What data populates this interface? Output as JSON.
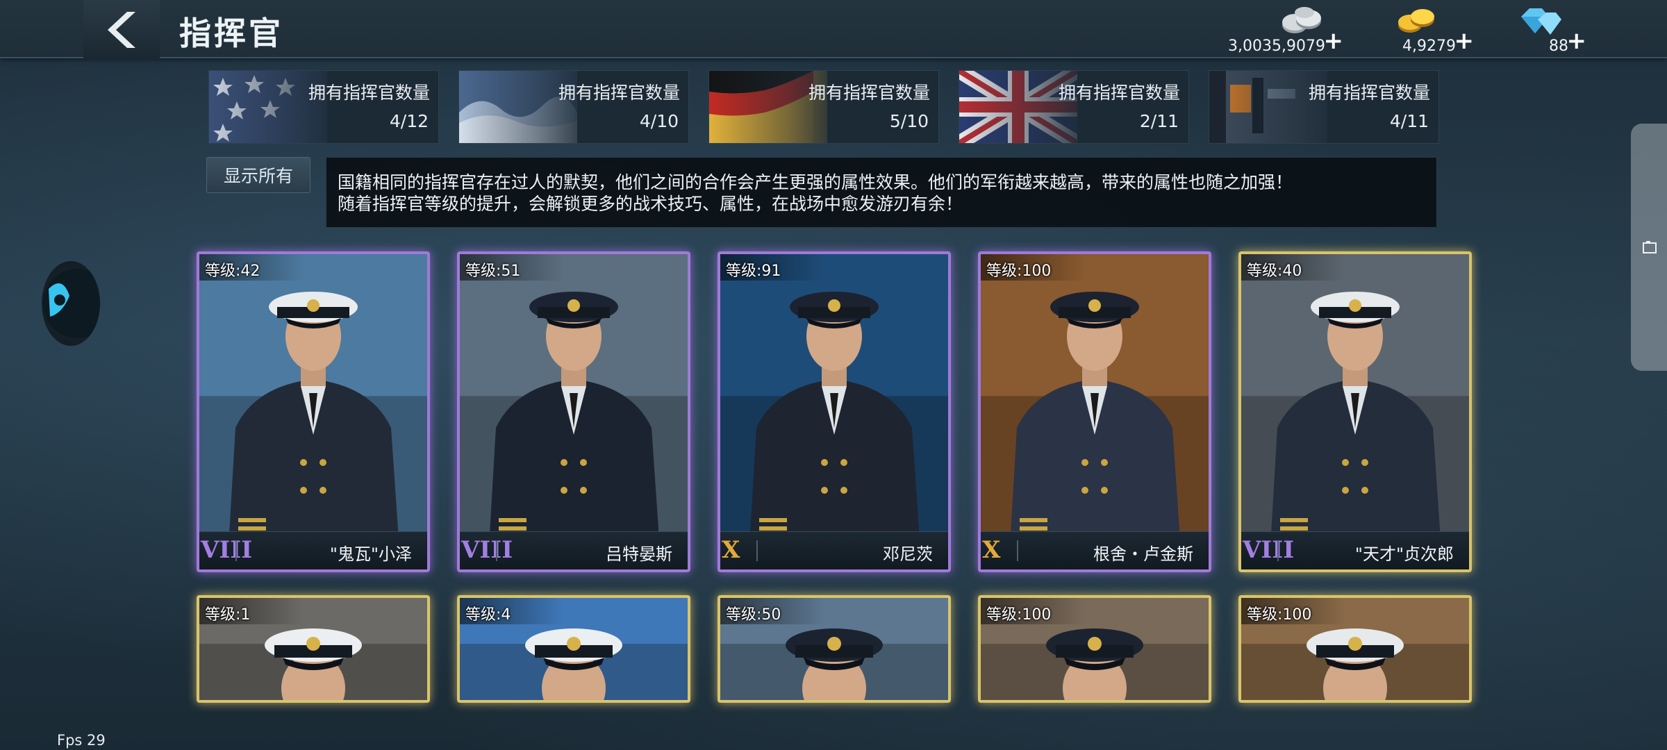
{
  "header": {
    "title": "指挥官",
    "currencies": [
      {
        "icon": "silver-coins-icon",
        "value": "3,0035,9079"
      },
      {
        "icon": "gold-coins-icon",
        "value": "4,9279"
      },
      {
        "icon": "diamond-icon",
        "value": "88"
      }
    ],
    "plus": "+"
  },
  "nations": [
    {
      "flag": "usa",
      "label": "拥有指挥官数量",
      "count": "4/12"
    },
    {
      "flag": "japan",
      "label": "拥有指挥官数量",
      "count": "4/10"
    },
    {
      "flag": "germany",
      "label": "拥有指挥官数量",
      "count": "5/10"
    },
    {
      "flag": "uk",
      "label": "拥有指挥官数量",
      "count": "2/11"
    },
    {
      "flag": "other",
      "label": "拥有指挥官数量",
      "count": "4/11"
    }
  ],
  "show_all_label": "显示所有",
  "description": [
    "国籍相同的指挥官存在过人的默契，他们之间的合作会产生更强的属性效果。他们的军衔越来越高，带来的属性也随之加强！",
    "随着指挥官等级的提升，会解锁更多的战术技巧、属性，在战场中愈发游刃有余！"
  ],
  "commanders_row1": [
    {
      "level": "等级:42",
      "rank": "VIII",
      "name": "\"鬼瓦\"小泽",
      "frame": "purple",
      "colors": {
        "bg": "#4d7aa0",
        "cap": "#e8ecef",
        "uniform": "#222a38"
      }
    },
    {
      "level": "等级:51",
      "rank": "VIII",
      "name": "吕特晏斯",
      "frame": "purple",
      "colors": {
        "bg": "#5b6f80",
        "cap": "#1c2433",
        "uniform": "#1b2230"
      }
    },
    {
      "level": "等级:91",
      "rank": "X",
      "name": "邓尼茨",
      "frame": "purple",
      "colors": {
        "bg": "#1e4c78",
        "cap": "#1c2230",
        "uniform": "#1e2430"
      }
    },
    {
      "level": "等级:100",
      "rank": "X",
      "name": "根舍・卢金斯",
      "frame": "purple",
      "colors": {
        "bg": "#8a5a30",
        "cap": "#1c2230",
        "uniform": "#2b3346"
      }
    },
    {
      "level": "等级:40",
      "rank": "VIII",
      "name": "\"天才\"贞次郎",
      "frame": "gold",
      "colors": {
        "bg": "#5c6670",
        "cap": "#e6eaec",
        "uniform": "#242d3c"
      }
    }
  ],
  "commanders_row2": [
    {
      "level": "等级:1",
      "colors": {
        "bg": "#6c6a66",
        "cap": "#eceff1"
      }
    },
    {
      "level": "等级:4",
      "colors": {
        "bg": "#3f78b8",
        "cap": "#eceff1"
      }
    },
    {
      "level": "等级:50",
      "colors": {
        "bg": "#5d7790",
        "cap": "#1b2330"
      }
    },
    {
      "level": "等级:100",
      "colors": {
        "bg": "#7a6a5a",
        "cap": "#1b2330"
      }
    },
    {
      "level": "等级:100",
      "colors": {
        "bg": "#8a6a48",
        "cap": "#e6eaec"
      }
    }
  ],
  "fps": "Fps 29"
}
